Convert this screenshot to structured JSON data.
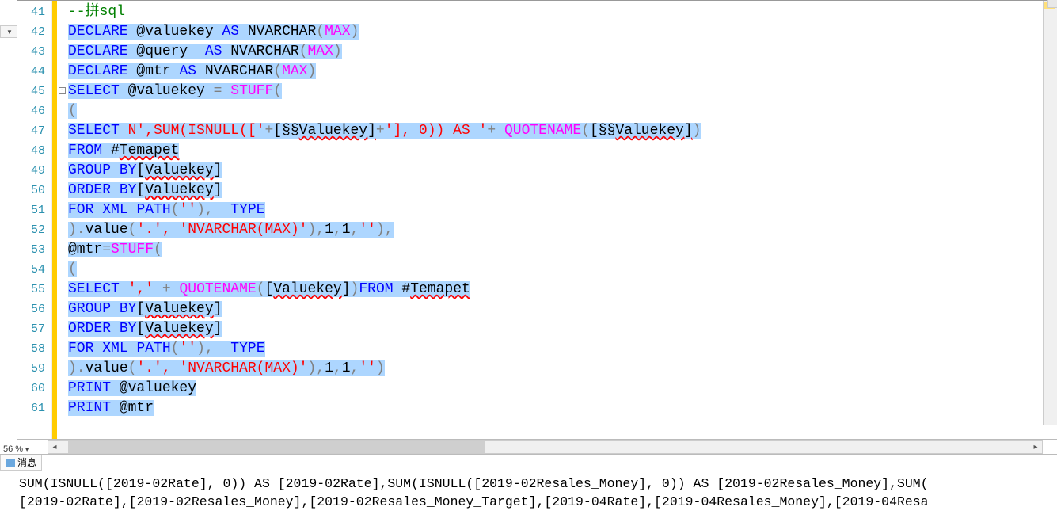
{
  "toolbar": {
    "format_dd": ""
  },
  "zoom": "56 %",
  "gutter_first": 41,
  "gutter_count": 21,
  "fold": {
    "collapse_glyph": "-",
    "at_line": 45
  },
  "lines": [
    {
      "tokens": [
        [
          "cmt",
          "--拼sql"
        ]
      ],
      "sel": false,
      "sqSpans": []
    },
    {
      "tokens": [
        [
          "kw",
          "DECLARE"
        ],
        [
          "",
          " @valuekey "
        ],
        [
          "kw",
          "AS"
        ],
        [
          "",
          " NVARCHAR"
        ],
        [
          "gray",
          "("
        ],
        [
          "func",
          "MAX"
        ],
        [
          "gray",
          ")"
        ]
      ],
      "sel": true,
      "sqSpans": []
    },
    {
      "tokens": [
        [
          "kw",
          "DECLARE"
        ],
        [
          "",
          " @query  "
        ],
        [
          "kw",
          "AS"
        ],
        [
          "",
          " NVARCHAR"
        ],
        [
          "gray",
          "("
        ],
        [
          "func",
          "MAX"
        ],
        [
          "gray",
          ")"
        ]
      ],
      "sel": true,
      "sqSpans": []
    },
    {
      "tokens": [
        [
          "kw",
          "DECLARE"
        ],
        [
          "",
          " @mtr "
        ],
        [
          "kw",
          "AS"
        ],
        [
          "",
          " NVARCHAR"
        ],
        [
          "gray",
          "("
        ],
        [
          "func",
          "MAX"
        ],
        [
          "gray",
          ")"
        ]
      ],
      "sel": true,
      "sqSpans": []
    },
    {
      "tokens": [
        [
          "kw",
          "SELECT"
        ],
        [
          "",
          " @valuekey "
        ],
        [
          "gray",
          "="
        ],
        [
          "",
          " "
        ],
        [
          "func",
          "STUFF"
        ],
        [
          "gray",
          "("
        ]
      ],
      "sel": true,
      "sqSpans": []
    },
    {
      "tokens": [
        [
          "gray",
          "("
        ]
      ],
      "sel": true,
      "sqSpans": []
    },
    {
      "tokens": [
        [
          "kw",
          "SELECT"
        ],
        [
          "",
          " "
        ],
        [
          "str",
          "N',SUM(ISNULL(['"
        ],
        [
          "gray",
          "+"
        ],
        [
          "",
          "[Valuekey]"
        ],
        [
          "gray",
          "+"
        ],
        [
          "str",
          "'], 0)) AS '"
        ],
        [
          "gray",
          "+"
        ],
        [
          "",
          " "
        ],
        [
          "func",
          "QUOTENAME"
        ],
        [
          "gray",
          "("
        ],
        [
          "",
          "[Valuekey]"
        ],
        [
          "gray",
          ")"
        ]
      ],
      "sel": true,
      "sqSpans": [
        "Valuekey",
        "Valuekey"
      ]
    },
    {
      "tokens": [
        [
          "kw",
          "FROM"
        ],
        [
          "",
          " #Temapet"
        ]
      ],
      "sel": true,
      "sqSpans": [
        "Temapet"
      ]
    },
    {
      "tokens": [
        [
          "kw",
          "GROUP"
        ],
        [
          "",
          " "
        ],
        [
          "kw",
          "BY"
        ],
        [
          "",
          "[Valuekey]"
        ]
      ],
      "sel": true,
      "sqSpans": [
        "Valuekey"
      ]
    },
    {
      "tokens": [
        [
          "kw",
          "ORDER"
        ],
        [
          "",
          " "
        ],
        [
          "kw",
          "BY"
        ],
        [
          "",
          "[Valuekey]"
        ]
      ],
      "sel": true,
      "sqSpans": [
        "Valuekey"
      ]
    },
    {
      "tokens": [
        [
          "kw",
          "FOR"
        ],
        [
          "",
          " "
        ],
        [
          "kw",
          "XML"
        ],
        [
          "",
          " "
        ],
        [
          "kw",
          "PATH"
        ],
        [
          "gray",
          "("
        ],
        [
          "str",
          "''"
        ],
        [
          "gray",
          "),"
        ],
        [
          "",
          "  "
        ],
        [
          "kw",
          "TYPE"
        ]
      ],
      "sel": true,
      "sqSpans": []
    },
    {
      "tokens": [
        [
          "gray",
          ")."
        ],
        [
          "",
          "value"
        ],
        [
          "gray",
          "("
        ],
        [
          "str",
          "'.', 'NVARCHAR(MAX)'"
        ],
        [
          "gray",
          "),"
        ],
        [
          "",
          "1"
        ],
        [
          "gray",
          ","
        ],
        [
          "",
          "1"
        ],
        [
          "gray",
          ","
        ],
        [
          "str",
          "''"
        ],
        [
          "gray",
          "),"
        ]
      ],
      "sel": true,
      "sqSpans": []
    },
    {
      "tokens": [
        [
          "",
          "@mtr"
        ],
        [
          "gray",
          "="
        ],
        [
          "func",
          "STUFF"
        ],
        [
          "gray",
          "("
        ]
      ],
      "sel": true,
      "sqSpans": []
    },
    {
      "tokens": [
        [
          "gray",
          "("
        ]
      ],
      "sel": true,
      "sqSpans": []
    },
    {
      "tokens": [
        [
          "kw",
          "SELECT"
        ],
        [
          "",
          " "
        ],
        [
          "str",
          "','"
        ],
        [
          "",
          " "
        ],
        [
          "gray",
          "+"
        ],
        [
          "",
          " "
        ],
        [
          "func",
          "QUOTENAME"
        ],
        [
          "gray",
          "("
        ],
        [
          "",
          "[Valuekey]"
        ],
        [
          "gray",
          ")"
        ],
        [
          "kw",
          "FROM"
        ],
        [
          "",
          " #Temapet"
        ]
      ],
      "sel": true,
      "sqSpans": [
        "Valuekey",
        "Temapet"
      ]
    },
    {
      "tokens": [
        [
          "kw",
          "GROUP"
        ],
        [
          "",
          " "
        ],
        [
          "kw",
          "BY"
        ],
        [
          "",
          "[Valuekey]"
        ]
      ],
      "sel": true,
      "sqSpans": [
        "Valuekey"
      ]
    },
    {
      "tokens": [
        [
          "kw",
          "ORDER"
        ],
        [
          "",
          " "
        ],
        [
          "kw",
          "BY"
        ],
        [
          "",
          "[Valuekey]"
        ]
      ],
      "sel": true,
      "sqSpans": [
        "Valuekey"
      ]
    },
    {
      "tokens": [
        [
          "kw",
          "FOR"
        ],
        [
          "",
          " "
        ],
        [
          "kw",
          "XML"
        ],
        [
          "",
          " "
        ],
        [
          "kw",
          "PATH"
        ],
        [
          "gray",
          "("
        ],
        [
          "str",
          "''"
        ],
        [
          "gray",
          "),"
        ],
        [
          "",
          "  "
        ],
        [
          "kw",
          "TYPE"
        ]
      ],
      "sel": true,
      "sqSpans": []
    },
    {
      "tokens": [
        [
          "gray",
          ")."
        ],
        [
          "",
          "value"
        ],
        [
          "gray",
          "("
        ],
        [
          "str",
          "'.', 'NVARCHAR(MAX)'"
        ],
        [
          "gray",
          "),"
        ],
        [
          "",
          "1"
        ],
        [
          "gray",
          ","
        ],
        [
          "",
          "1"
        ],
        [
          "gray",
          ","
        ],
        [
          "str",
          "''"
        ],
        [
          "gray",
          ")"
        ]
      ],
      "sel": true,
      "sqSpans": []
    },
    {
      "tokens": [
        [
          "kw",
          "PRINT"
        ],
        [
          "",
          " @valuekey"
        ]
      ],
      "sel": true,
      "sqSpans": []
    },
    {
      "tokens": [
        [
          "kw",
          "PRINT"
        ],
        [
          "",
          " @mtr"
        ]
      ],
      "sel": true,
      "sqSpans": []
    }
  ],
  "messages_tab": "消息",
  "messages": [
    "SUM(ISNULL([2019-02Rate], 0)) AS [2019-02Rate],SUM(ISNULL([2019-02Resales_Money], 0)) AS [2019-02Resales_Money],SUM(",
    "[2019-02Rate],[2019-02Resales_Money],[2019-02Resales_Money_Target],[2019-04Rate],[2019-04Resales_Money],[2019-04Resa"
  ],
  "hscroll": {
    "thumb_left_pct": 2,
    "thumb_width_pct": 42
  }
}
